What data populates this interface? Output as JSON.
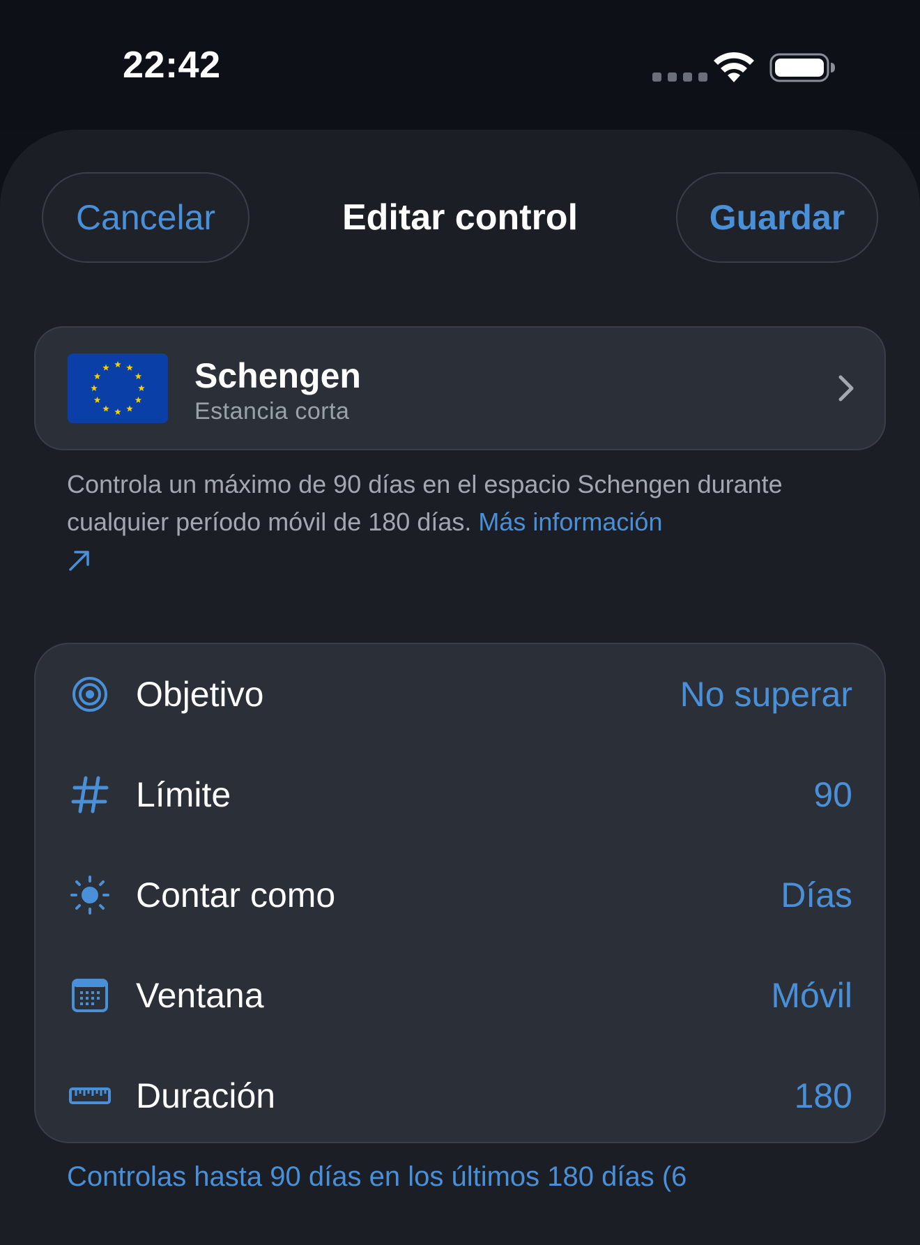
{
  "status_bar": {
    "time": "22:42",
    "icons": [
      "signal-dots-icon",
      "wifi-icon",
      "battery-icon"
    ]
  },
  "nav": {
    "cancel_label": "Cancelar",
    "title": "Editar control",
    "save_label": "Guardar"
  },
  "region": {
    "title": "Schengen",
    "subtitle": "Estancia corta",
    "flag_icon": "eu-flag-icon"
  },
  "description": {
    "text": "Controla un máximo de 90 días en el espacio Schengen durante cualquier período móvil de 180 días.",
    "link_label": "Más información"
  },
  "settings": [
    {
      "label": "Objetivo",
      "value": "No superar",
      "icon": "target-icon"
    },
    {
      "label": "Límite",
      "value": "90",
      "icon": "hash-icon"
    },
    {
      "label": "Contar como",
      "value": "Días",
      "icon": "sun-icon"
    },
    {
      "label": "Ventana",
      "value": "Móvil",
      "icon": "calendar-icon"
    },
    {
      "label": "Duración",
      "value": "180",
      "icon": "ruler-icon"
    }
  ],
  "footer": {
    "text": "Controlas hasta 90 días en los últimos 180 días (6"
  },
  "colors": {
    "accent": "#4a90d9",
    "background": "#1b1e24",
    "card": "#2b3038",
    "flag_blue": "#0b3fa8",
    "flag_star": "#f5d000"
  }
}
